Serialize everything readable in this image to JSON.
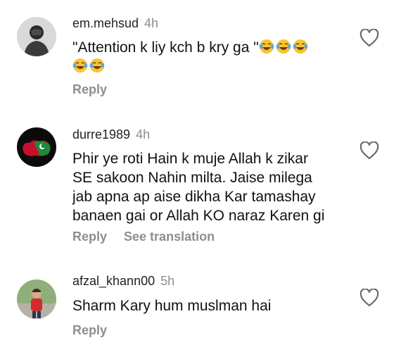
{
  "comments": [
    {
      "username": "em.mehsud",
      "time": "4h",
      "text_line1": "\"Attention k liy kch b kry ga \"",
      "emoji_icon": "face-with-tears-of-joy-icon",
      "reply_label": "Reply"
    },
    {
      "username": "durre1989",
      "time": "4h",
      "text_lines": [
        "Phir ye roti Hain k muje Allah k zikar",
        "SE sakoon Nahin milta. Jaise milega",
        "jab apna ap aise dikha Kar tamashay",
        "banaen gai or Allah KO naraz Karen gi"
      ],
      "reply_label": "Reply",
      "translate_label": "See translation"
    },
    {
      "username": "afzal_khann00",
      "time": "5h",
      "text": "Sharm Kary hum muslman hai",
      "reply_label": "Reply"
    }
  ],
  "colors": {
    "text": "#111111",
    "muted": "#8e8e8e",
    "emoji_face": "#f7c531",
    "emoji_tears": "#5aa7e6"
  }
}
